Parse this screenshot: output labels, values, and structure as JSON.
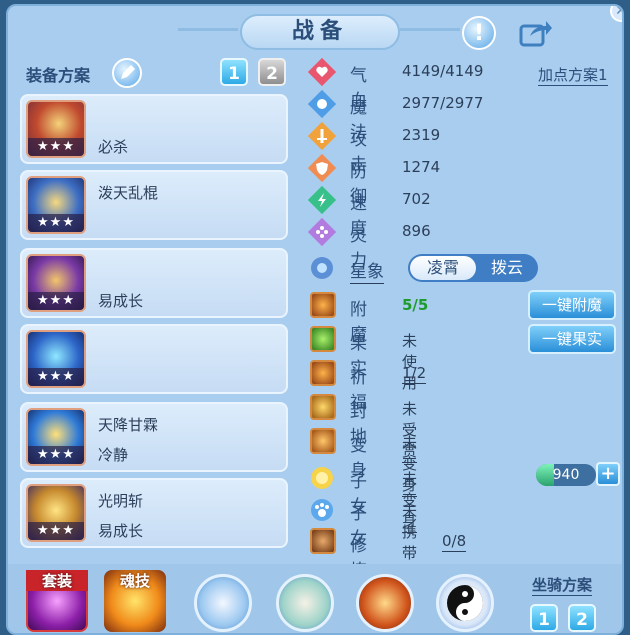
{
  "header": {
    "title": "战备"
  },
  "equipment": {
    "label": "装备方案",
    "tabs": [
      "1",
      "2"
    ],
    "slots": [
      {
        "line1": "",
        "line2": "必杀",
        "stars": "★★★"
      },
      {
        "line1": "泼天乱棍",
        "line2": "",
        "stars": "★★★"
      },
      {
        "line1": "",
        "line2": "易成长",
        "stars": "★★★"
      },
      {
        "line1": "",
        "line2": "",
        "stars": "★★★"
      },
      {
        "line1": "天降甘霖",
        "line2": "冷静",
        "stars": "★★★"
      },
      {
        "line1": "光明斩",
        "line2": "易成长",
        "stars": "★★★"
      }
    ]
  },
  "attributes": {
    "plan_label": "加点方案1",
    "items": [
      {
        "name": "气血",
        "value": "4149/4149",
        "color": "#e9576f"
      },
      {
        "name": "魔法",
        "value": "2977/2977",
        "color": "#4f9de6"
      },
      {
        "name": "攻击",
        "value": "2319",
        "color": "#f1a23a"
      },
      {
        "name": "防御",
        "value": "1274",
        "color": "#f08b52"
      },
      {
        "name": "速度",
        "value": "702",
        "color": "#38c08b"
      },
      {
        "name": "灵力",
        "value": "896",
        "color": "#b27be0"
      }
    ]
  },
  "xingxiang": {
    "label": "星象",
    "options": [
      "凌霄",
      "拨云"
    ]
  },
  "features": [
    {
      "name": "附魔",
      "value": "5/5"
    },
    {
      "name": "果实",
      "value": "未使用"
    },
    {
      "name": "祈福",
      "value": "1/2"
    },
    {
      "name": "封地",
      "value": "未受赏"
    },
    {
      "name": "变身",
      "value": "未变身"
    },
    {
      "name": "子女",
      "value": "未变身"
    },
    {
      "name": "子女",
      "value": "未携带"
    },
    {
      "name": "修炼觉醒",
      "value": "0/8"
    }
  ],
  "buttons": {
    "enchant": "一键附魔",
    "fruit": "一键果实"
  },
  "child_energy": {
    "value": "940",
    "fraction": 0.3
  },
  "bottom": {
    "suit_label": "套装",
    "soul_label": "魂技",
    "mount_label": "坐骑方案",
    "mount_tabs": [
      "1",
      "2"
    ]
  }
}
